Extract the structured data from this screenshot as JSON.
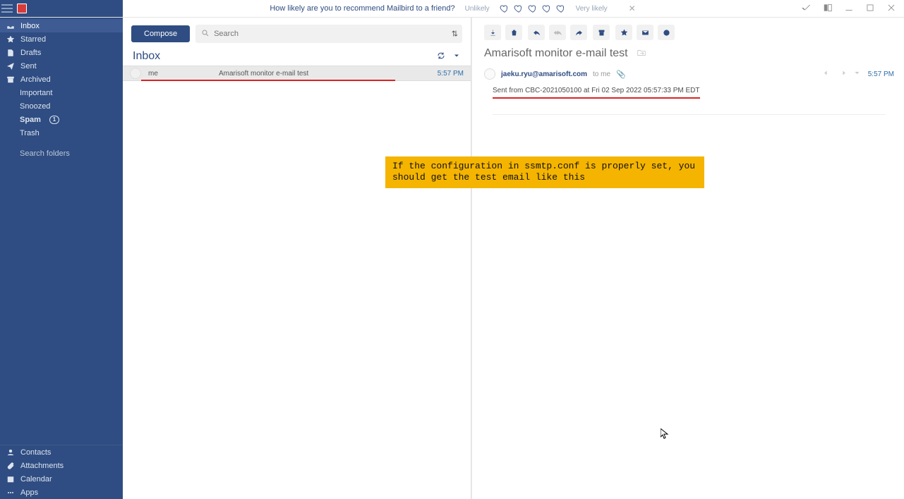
{
  "nps": {
    "question": "How likely are you to recommend Mailbird to a friend?",
    "unlikely": "Unlikely",
    "likely": "Very likely"
  },
  "sidebar": {
    "items": [
      {
        "icon": "inbox",
        "label": "Inbox",
        "active": true
      },
      {
        "icon": "star",
        "label": "Starred"
      },
      {
        "icon": "drafts",
        "label": "Drafts"
      },
      {
        "icon": "sent",
        "label": "Sent"
      },
      {
        "icon": "archive",
        "label": "Archived"
      }
    ],
    "subitems": [
      {
        "label": "Important"
      },
      {
        "label": "Snoozed"
      },
      {
        "label": "Spam",
        "count": "1",
        "bold": true
      },
      {
        "label": "Trash"
      }
    ],
    "search": "Search folders",
    "foot": [
      {
        "icon": "user",
        "label": "Contacts"
      },
      {
        "icon": "clip",
        "label": "Attachments"
      },
      {
        "icon": "cal",
        "label": "Calendar"
      },
      {
        "icon": "dots",
        "label": "Apps"
      }
    ]
  },
  "list": {
    "compose": "Compose",
    "search_placeholder": "Search",
    "title": "Inbox",
    "messages": [
      {
        "from": "me",
        "subject": "Amarisoft monitor e-mail test",
        "time": "5:57 PM"
      }
    ]
  },
  "reading": {
    "subject": "Amarisoft monitor e-mail test",
    "sender_email": "jaeku.ryu@amarisoft.com",
    "to": "to me",
    "time": "5:57 PM",
    "body": "Sent from CBC-2021050100 at Fri 02 Sep 2022 05:57:33 PM EDT"
  },
  "annotation": "If the configuration in ssmtp.conf is properly set, you should get the test email like this"
}
